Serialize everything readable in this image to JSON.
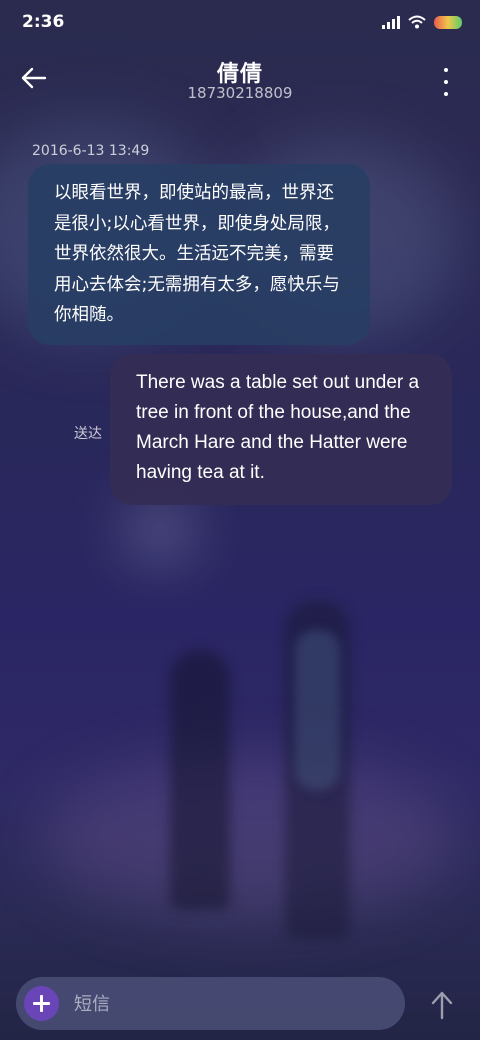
{
  "status_bar": {
    "time": "2:36",
    "signal_icon": "signal-bars-icon",
    "wifi_icon": "wifi-icon",
    "battery_icon": "battery-icon"
  },
  "header": {
    "back_icon": "arrow-left-icon",
    "contact_name": "倩倩",
    "contact_phone": "18730218809",
    "more_icon": "more-vertical-icon"
  },
  "conversation": {
    "timestamp": "2016-6-13 13:49",
    "messages": [
      {
        "direction": "incoming",
        "text": "以眼看世界，即使站的最高，世界还是很小;以心看世界，即使身处局限，世界依然很大。生活远不完美，需要用心去体会;无需拥有太多，愿快乐与你相随。"
      },
      {
        "direction": "outgoing",
        "text": "There was a table set out under a tree in front of the house,and the March Hare and the Hatter were having tea at it.",
        "status": "送达"
      }
    ]
  },
  "composer": {
    "attach_icon": "plus-icon",
    "placeholder": "短信",
    "value": "",
    "send_icon": "arrow-up-icon"
  },
  "colors": {
    "accent": "#6a45b8",
    "incoming_bubble": "#283e64",
    "outgoing_bubble": "#342c54"
  }
}
